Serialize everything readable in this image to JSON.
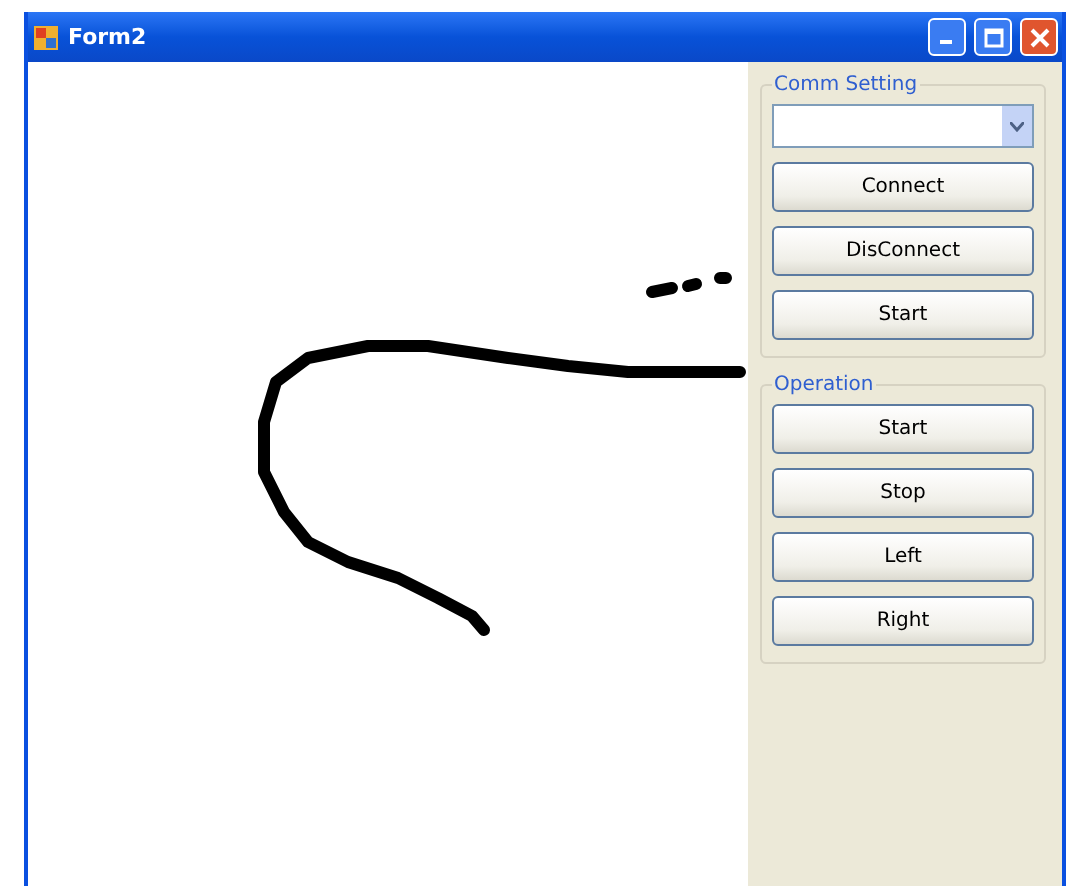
{
  "window": {
    "title": "Form2"
  },
  "groups": [
    {
      "title": "Comm Setting",
      "controls": [
        {
          "kind": "dropdown"
        },
        {
          "kind": "button",
          "label": "Connect"
        },
        {
          "kind": "button",
          "label": "DisConnect"
        },
        {
          "kind": "button",
          "label": "Start"
        }
      ]
    },
    {
      "title": "Operation",
      "controls": [
        {
          "kind": "button",
          "label": "Start"
        },
        {
          "kind": "button",
          "label": "Stop"
        },
        {
          "kind": "button",
          "label": "Left"
        },
        {
          "kind": "button",
          "label": "Right"
        }
      ]
    }
  ]
}
